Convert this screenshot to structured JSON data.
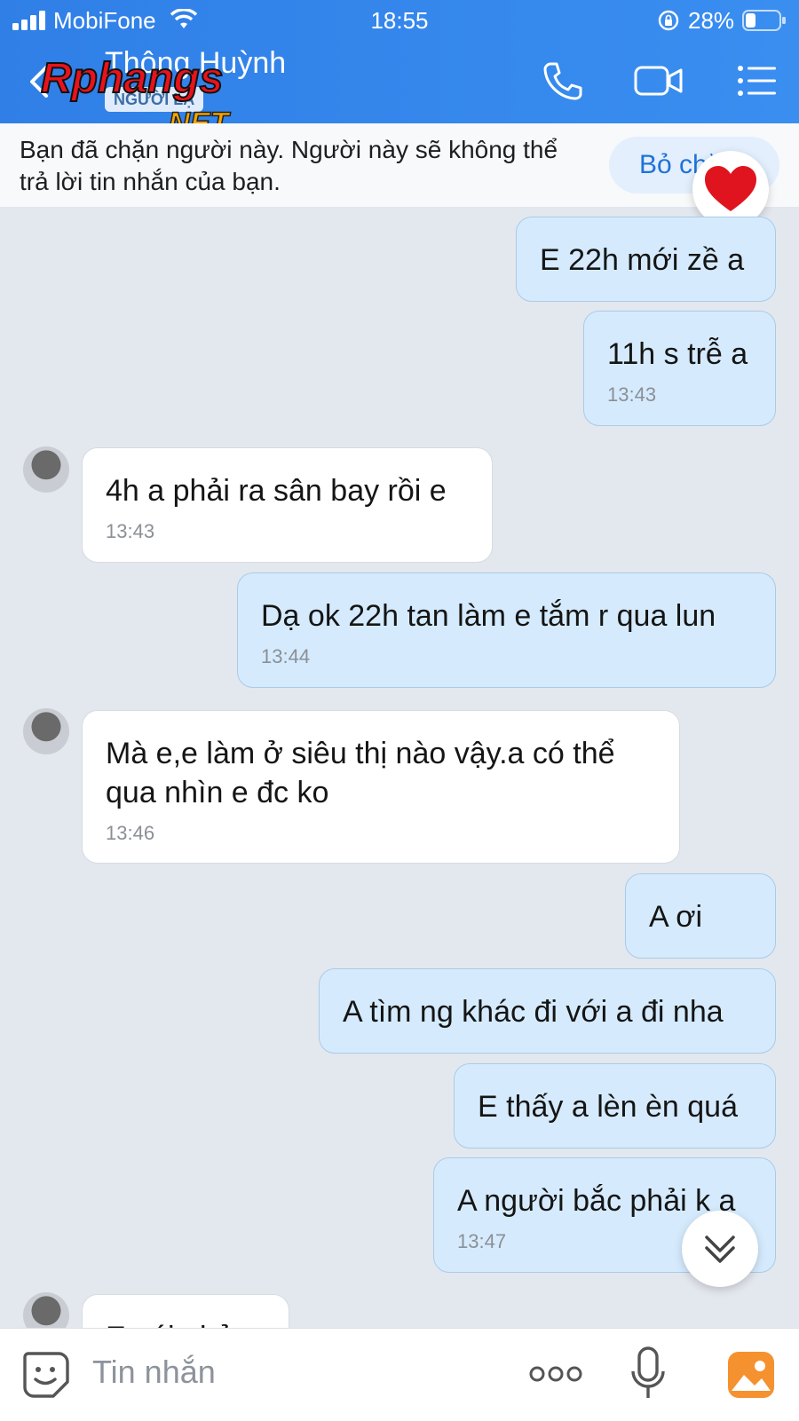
{
  "status_bar": {
    "carrier": "MobiFone",
    "time": "18:55",
    "battery": "28%"
  },
  "header": {
    "contact_name": "Thông Huỳnh",
    "badge": "NGƯỜI LẠ",
    "watermark": "Rphangs.NET",
    "icons": [
      "back-icon",
      "phone-icon",
      "video-call-icon",
      "menu-icon"
    ]
  },
  "banner": {
    "text": "Bạn đã chặn người này. Người này sẽ không thể trả lời tin nhắn của bạn.",
    "unblock_label": "Bỏ chặn"
  },
  "messages": [
    {
      "side": "me",
      "text": "E 22h mới zề a",
      "time": ""
    },
    {
      "side": "me",
      "text": "11h s trễ a",
      "time": "13:43"
    },
    {
      "side": "them",
      "text": "4h a phải ra sân bay rồi e",
      "time": "13:43"
    },
    {
      "side": "me",
      "text": "Dạ ok 22h tan làm e tắm r qua lun",
      "time": "13:44"
    },
    {
      "side": "them",
      "text": "Mà e,e làm ở siêu thị nào vậy.a có thể qua nhìn e đc ko",
      "time": "13:46"
    },
    {
      "side": "me",
      "text": "A ơi",
      "time": ""
    },
    {
      "side": "me",
      "text": "A tìm ng khác đi với a đi nha",
      "time": ""
    },
    {
      "side": "me",
      "text": "E thấy a lèn èn quá",
      "time": ""
    },
    {
      "side": "me",
      "text": "A người bắc phải k ạ",
      "time": "13:47"
    },
    {
      "side": "them",
      "text": "E nói nhỏ",
      "time": ""
    }
  ],
  "input": {
    "placeholder": "Tin nhắn"
  },
  "colors": {
    "header": "#3a8ef0",
    "my_bubble": "#d5ebfd",
    "their_bubble": "#ffffff",
    "background": "#e3e7ee"
  }
}
